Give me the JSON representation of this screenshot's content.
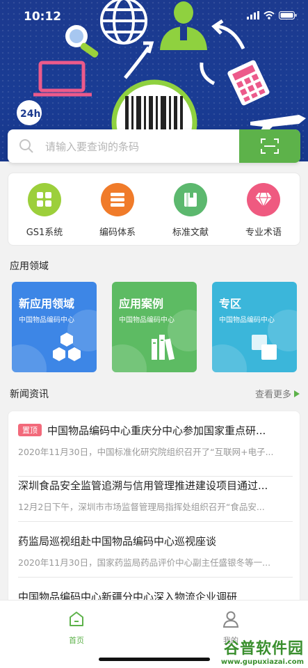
{
  "status_bar": {
    "time": "10:12"
  },
  "search": {
    "placeholder": "请输入要查询的条码"
  },
  "categories": [
    {
      "label": "GS1系统",
      "color": "#9ccf3b",
      "icon": "grid-icon"
    },
    {
      "label": "编码体系",
      "color": "#f07b2a",
      "icon": "database-icon"
    },
    {
      "label": "标准文献",
      "color": "#5cb86e",
      "icon": "book-icon"
    },
    {
      "label": "专业术语",
      "color": "#ef5a80",
      "icon": "diamond-icon"
    }
  ],
  "application_section": {
    "title": "应用领域"
  },
  "tiles": [
    {
      "title": "新应用领域",
      "subtitle": "中国物品编码中心",
      "color": "#3d86e6",
      "icon": "hexagons-icon"
    },
    {
      "title": "应用案例",
      "subtitle": "中国物品编码中心",
      "color": "#5dbb63",
      "icon": "books-icon"
    },
    {
      "title": "专区",
      "subtitle": "中国物品编码中心",
      "color": "#3bb6da",
      "icon": "squares-icon"
    }
  ],
  "news_section": {
    "title": "新闻资讯",
    "more_label": "查看更多"
  },
  "news": [
    {
      "badge": "置顶",
      "title": "中国物品编码中心重庆分中心参加国家重点研...",
      "desc": "2020年11月30日，中国标准化研究院组织召开了“互联网+电子..."
    },
    {
      "title": "深圳食品安全监管追溯与信用管理推进建设项目通过...",
      "desc": "12月2日下午，深圳市市场监督管理局指挥处组织召开“食品安..."
    },
    {
      "title": "药监局巡视组赴中国物品编码中心巡视座谈",
      "desc": "2020年11月30日，国家药监局药品评价中心副主任盛银冬等一..."
    },
    {
      "title": "中国物品编码中心新疆分中心深入物流企业调研",
      "desc": ""
    }
  ],
  "tabbar": {
    "home_label": "首页",
    "mine_label": "我的"
  },
  "watermark": {
    "name": "谷普软件园",
    "url": "www.gupuxiazai.com"
  },
  "colors": {
    "brand_green": "#5db24a",
    "banner_blue": "#1c3a8f"
  }
}
